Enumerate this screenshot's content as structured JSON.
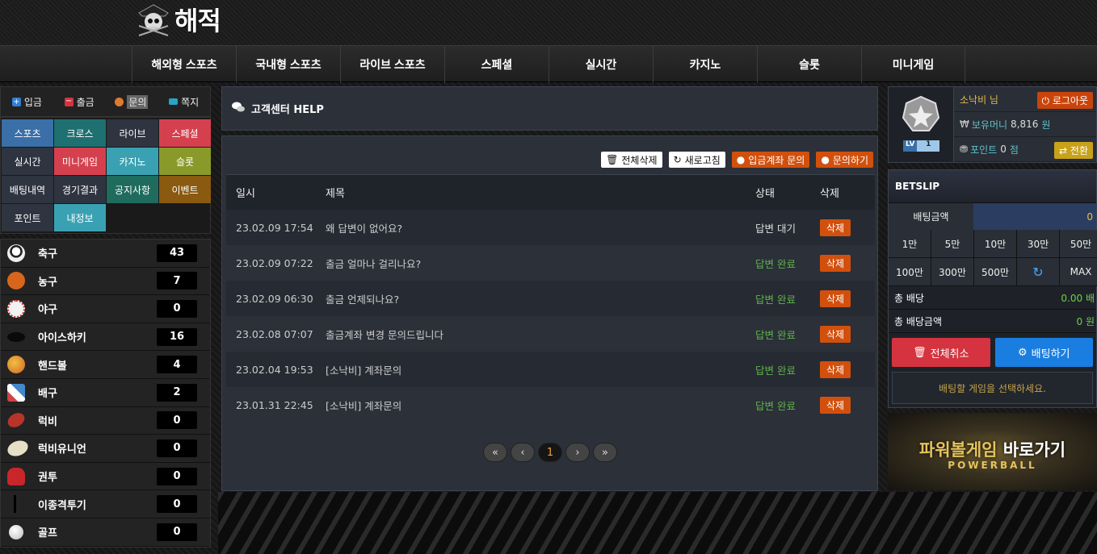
{
  "header": {
    "logo_text": "해적"
  },
  "nav": [
    {
      "label": "해외형 스포츠"
    },
    {
      "label": "국내형 스포츠"
    },
    {
      "label": "라이브 스포츠"
    },
    {
      "label": "스페셜"
    },
    {
      "label": "실시간"
    },
    {
      "label": "카지노"
    },
    {
      "label": "슬롯"
    },
    {
      "label": "미니게임"
    }
  ],
  "quick": [
    {
      "label": "입금",
      "icon": "plus-square-icon",
      "color": "#2f7fd6"
    },
    {
      "label": "출금",
      "icon": "minus-square-icon",
      "color": "#d4333f"
    },
    {
      "label": "문의",
      "icon": "chat-icon",
      "color": "#e07a30"
    },
    {
      "label": "쪽지",
      "icon": "envelope-icon",
      "color": "#2aa3c8"
    }
  ],
  "menu_grid": [
    {
      "label": "스포츠",
      "color": "#3a6fa8"
    },
    {
      "label": "크로스",
      "color": "#1f7070"
    },
    {
      "label": "라이브",
      "color": "#2e3440"
    },
    {
      "label": "스페셜",
      "color": "#d5404e"
    },
    {
      "label": "실시간",
      "color": "#2e3440"
    },
    {
      "label": "미니게임",
      "color": "#d5404e"
    },
    {
      "label": "카지노",
      "color": "#3aa1b3"
    },
    {
      "label": "슬롯",
      "color": "#8a9a2a"
    },
    {
      "label": "배팅내역",
      "color": "#2e3440"
    },
    {
      "label": "경기결과",
      "color": "#2e3440"
    },
    {
      "label": "공지사항",
      "color": "#1f6b5e"
    },
    {
      "label": "이벤트",
      "color": "#8a5a10"
    },
    {
      "label": "포인트",
      "color": "#2e3440"
    },
    {
      "label": "내정보",
      "color": "#3aa1b3"
    }
  ],
  "sports": [
    {
      "name": "축구",
      "count": "43",
      "icon": "soccer-ball-icon",
      "color": "#e8e8e8"
    },
    {
      "name": "농구",
      "count": "7",
      "icon": "basketball-icon",
      "color": "#d7661c"
    },
    {
      "name": "야구",
      "count": "0",
      "icon": "baseball-icon",
      "color": "#f2f2f2"
    },
    {
      "name": "아이스하키",
      "count": "16",
      "icon": "hockey-puck-icon",
      "color": "#111"
    },
    {
      "name": "핸드볼",
      "count": "4",
      "icon": "handball-icon",
      "color": "#e69a2e"
    },
    {
      "name": "배구",
      "count": "2",
      "icon": "volleyball-icon",
      "color": "#bbb"
    },
    {
      "name": "럭비",
      "count": "0",
      "icon": "rugby-ball-icon",
      "color": "#b8342a"
    },
    {
      "name": "럭비유니언",
      "count": "0",
      "icon": "rugby-union-icon",
      "color": "#e6dfc8"
    },
    {
      "name": "권투",
      "count": "0",
      "icon": "boxing-glove-icon",
      "color": "#c8262a"
    },
    {
      "name": "이종격투기",
      "count": "0",
      "icon": "mma-icon",
      "color": "#222"
    },
    {
      "name": "골프",
      "count": "0",
      "icon": "golf-ball-icon",
      "color": "#f0f0f0"
    }
  ],
  "main": {
    "title": "고객센터 HELP",
    "buttons": {
      "delete_all": "전체삭제",
      "refresh": "새로고침",
      "deposit_inquiry": "입금계좌 문의",
      "inquire": "문의하기"
    },
    "columns": {
      "date": "일시",
      "title": "제목",
      "status": "상태",
      "delete": "삭제"
    },
    "rows": [
      {
        "date": "23.02.09 17:54",
        "title": "왜 답변이 없어요?",
        "status": "답변 대기",
        "done": false,
        "delete": "삭제"
      },
      {
        "date": "23.02.09 07:22",
        "title": "출금 얼마나 걸리나요?",
        "status": "답변 완료",
        "done": true,
        "delete": "삭제"
      },
      {
        "date": "23.02.09 06:30",
        "title": "출금 언제되나요?",
        "status": "답변 완료",
        "done": true,
        "delete": "삭제"
      },
      {
        "date": "23.02.08 07:07",
        "title": "출금계좌 변경 문의드립니다",
        "status": "답변 완료",
        "done": true,
        "delete": "삭제"
      },
      {
        "date": "23.02.04 19:53",
        "title": "[소낙비] 계좌문의",
        "status": "답변 완료",
        "done": true,
        "delete": "삭제"
      },
      {
        "date": "23.01.31 22:45",
        "title": "[소낙비] 계좌문의",
        "status": "답변 완료",
        "done": true,
        "delete": "삭제"
      }
    ],
    "pagination": {
      "first": "«",
      "prev": "‹",
      "current": "1",
      "next": "›",
      "last": "»"
    }
  },
  "user": {
    "level_badge": "LV",
    "level": "1",
    "name": "소낙비 님",
    "logout": "로그아웃",
    "money_label": "보유머니",
    "money_currency": "₩",
    "money": "8,816",
    "money_unit": "원",
    "point_label": "포인트",
    "point": "0",
    "point_unit": "점",
    "convert": "전환"
  },
  "betslip": {
    "title": "BETSLIP",
    "amount_label": "배팅금액",
    "amount_value": "0",
    "chips": [
      "1만",
      "5만",
      "10만",
      "30만",
      "50만",
      "100만",
      "300만",
      "500만",
      "↻",
      "MAX"
    ],
    "total_odds_label": "총 배당",
    "total_odds": "0.00 배",
    "total_payout_label": "총 배당금액",
    "total_payout": "0 원",
    "cancel_all": "전체취소",
    "place_bet": "배팅하기",
    "empty_message": "배팅할 게임을 선택하세요."
  },
  "banner": {
    "line1_a": "파워볼게임",
    "line1_b": " 바로가기",
    "line2": "POWERBALL"
  }
}
